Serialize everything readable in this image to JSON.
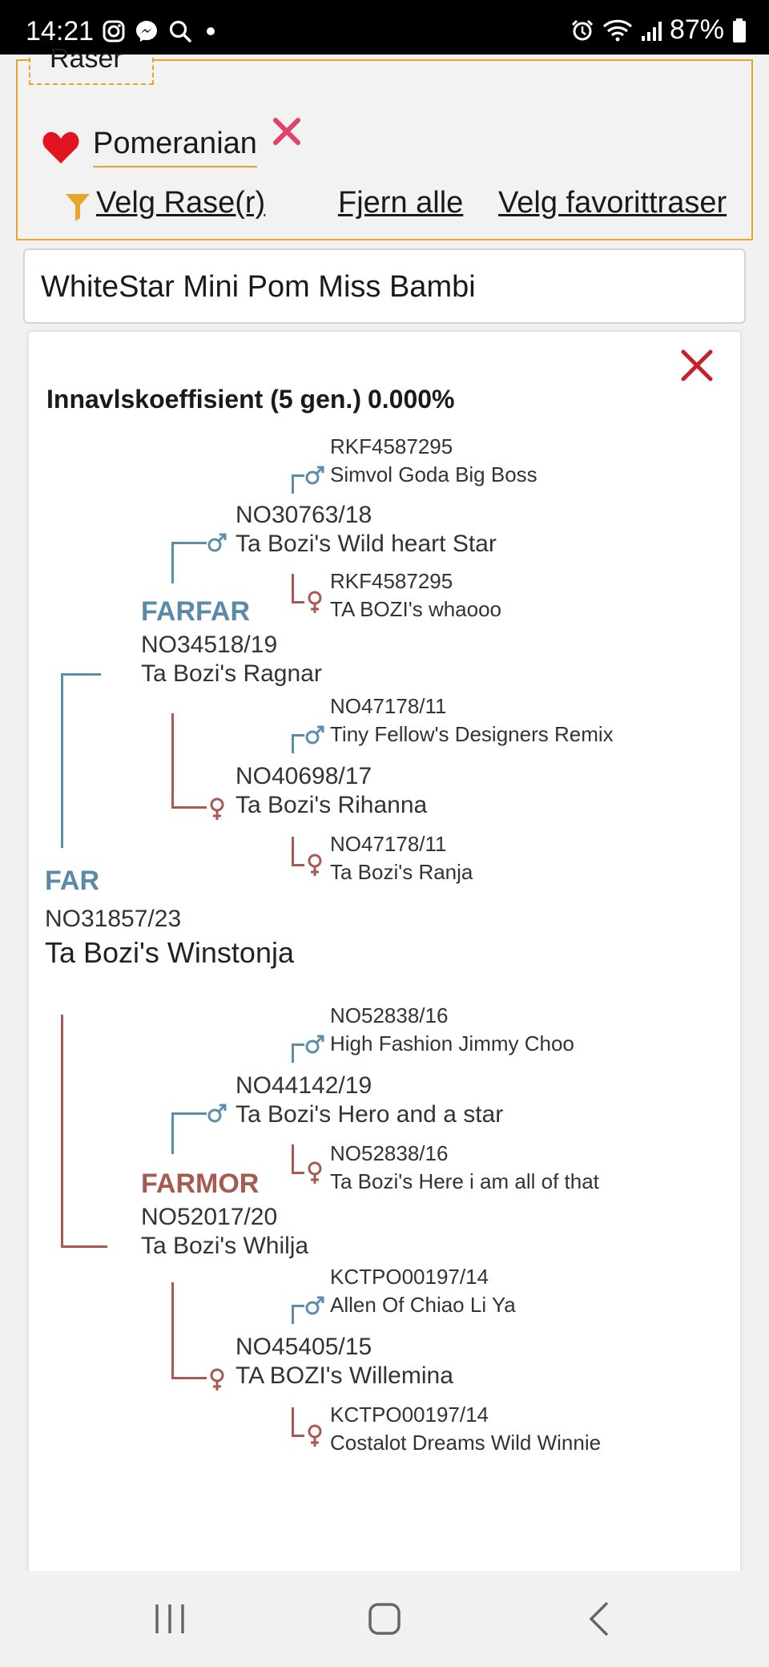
{
  "status_bar": {
    "time": "14:21",
    "battery": "87%",
    "icons": [
      "instagram-icon",
      "messenger-icon",
      "search-icon",
      "dot-icon",
      "alarm-icon",
      "wifi-icon",
      "signal-icon",
      "battery-icon"
    ]
  },
  "breed_filter": {
    "legend": "Raser",
    "selected_breed": "Pomeranian",
    "actions": {
      "select_breeds": "Velg Rase(r)",
      "remove_all": "Fjern alle",
      "select_favorites": "Velg favorittraser"
    },
    "colors": {
      "accent": "#e6a52c",
      "favorite": "#e0151f",
      "remove": "#e3406a"
    }
  },
  "search": {
    "value": "WhiteStar Mini Pom Miss Bambi"
  },
  "pedigree": {
    "coefficient_label": "Innavlskoeffisient (5 gen.)",
    "coefficient_value": "0.000%",
    "colors": {
      "male": "#5d8dab",
      "female": "#a65a53"
    },
    "far": {
      "role": "FAR",
      "reg": "NO31857/23",
      "name": "Ta Bozi's Winstonja",
      "farfar": {
        "role": "FARFAR",
        "reg": "NO34518/19",
        "name": "Ta Bozi's Ragnar",
        "sire": {
          "reg": "NO30763/18",
          "name": "Ta Bozi's Wild heart Star",
          "sire": {
            "reg": "RKF4587295",
            "name": "Simvol Goda Big Boss"
          },
          "dam": {
            "reg": "RKF4587295",
            "name": "TA BOZI's whaooo"
          }
        },
        "dam": {
          "reg": "NO40698/17",
          "name": "Ta Bozi's Rihanna",
          "sire": {
            "reg": "NO47178/11",
            "name": "Tiny Fellow's Designers Remix"
          },
          "dam": {
            "reg": "NO47178/11",
            "name": "Ta Bozi's Ranja"
          }
        }
      },
      "farmor": {
        "role": "FARMOR",
        "reg": "NO52017/20",
        "name": "Ta Bozi's Whilja",
        "sire": {
          "reg": "NO44142/19",
          "name": "Ta Bozi's Hero and a star",
          "sire": {
            "reg": "NO52838/16",
            "name": "High Fashion Jimmy Choo"
          },
          "dam": {
            "reg": "NO52838/16",
            "name": "Ta Bozi's Here i am all of that"
          }
        },
        "dam": {
          "reg": "NO45405/15",
          "name": "TA BOZI's Willemina",
          "sire": {
            "reg": "KCTPO00197/14",
            "name": "Allen Of Chiao Li Ya"
          },
          "dam": {
            "reg": "KCTPO00197/14",
            "name": "Costalot Dreams Wild Winnie"
          }
        }
      }
    }
  },
  "navigation_bar": {
    "buttons": [
      "recent-apps-icon",
      "home-icon",
      "back-icon"
    ]
  }
}
